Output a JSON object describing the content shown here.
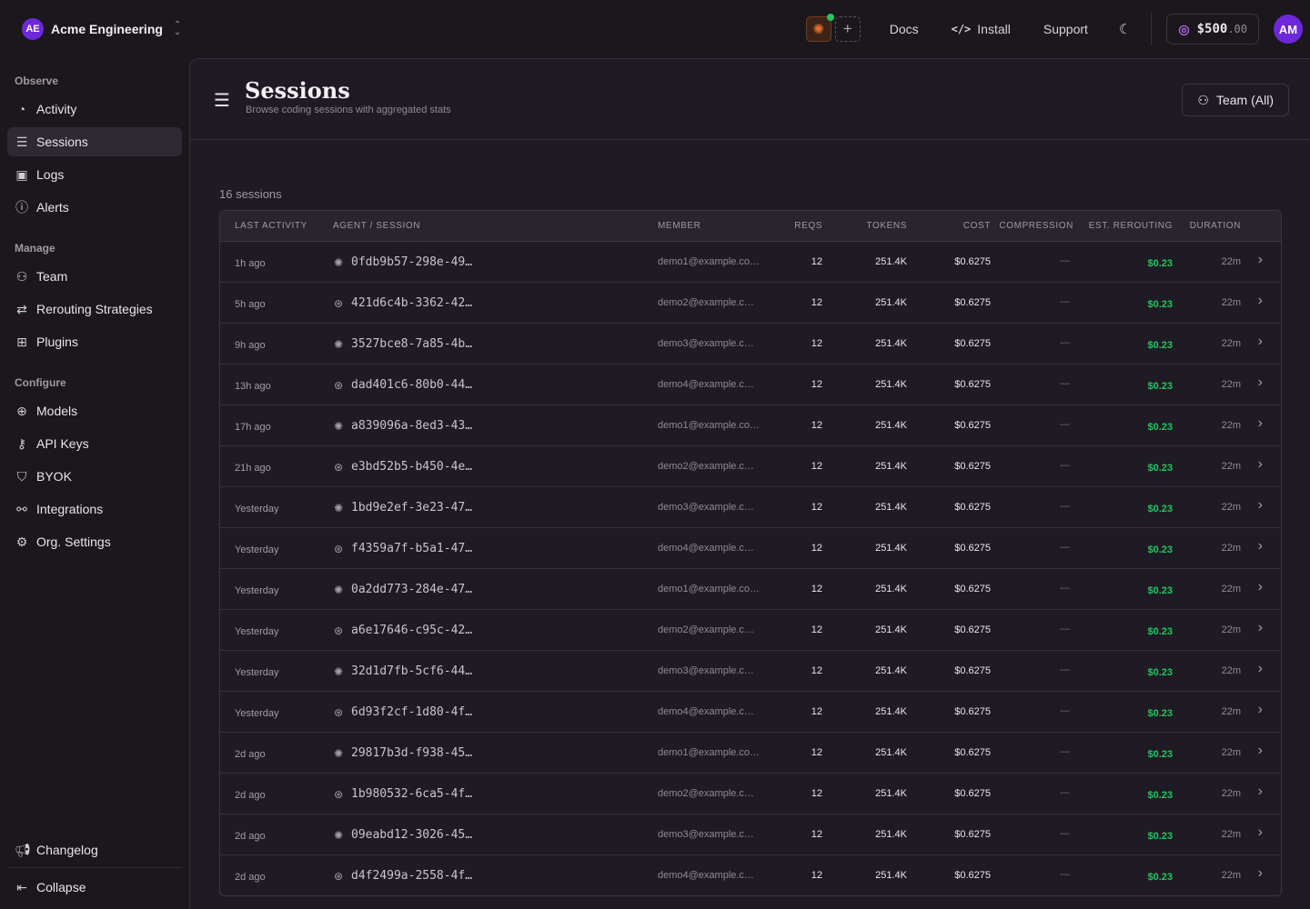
{
  "org": {
    "initials": "AE",
    "name": "Acme Engineering"
  },
  "topnav": {
    "docs": "Docs",
    "install": "Install",
    "support": "Support",
    "credits_main": "$500",
    "credits_cents": ".00",
    "user_initials": "AM"
  },
  "sidebar": {
    "groups": [
      {
        "label": "Observe",
        "items": [
          "Activity",
          "Sessions",
          "Logs",
          "Alerts"
        ]
      },
      {
        "label": "Manage",
        "items": [
          "Team",
          "Rerouting Strategies",
          "Plugins"
        ]
      },
      {
        "label": "Configure",
        "items": [
          "Models",
          "API Keys",
          "BYOK",
          "Integrations",
          "Org. Settings"
        ]
      }
    ],
    "active": "Sessions",
    "changelog": "Changelog",
    "collapse": "Collapse"
  },
  "page": {
    "title": "Sessions",
    "subtitle": "Browse coding sessions with aggregated stats",
    "team_filter": "Team (All)",
    "count_label": "16 sessions"
  },
  "table": {
    "headers": [
      "Last Activity",
      "Agent / Session",
      "Member",
      "Reqs",
      "Tokens",
      "Cost",
      "Compression",
      "Est. Rerouting",
      "Duration"
    ],
    "rows": [
      {
        "time": "1h ago",
        "agent": "claude",
        "session": "0fdb9b57-298e-49…",
        "member": "demo1@example.co…",
        "reqs": "12",
        "tokens": "251.4K",
        "cost": "$0.6275",
        "compression": "—",
        "rerouting": "$0.23",
        "duration": "22m"
      },
      {
        "time": "5h ago",
        "agent": "openai",
        "session": "421d6c4b-3362-42…",
        "member": "demo2@example.c…",
        "reqs": "12",
        "tokens": "251.4K",
        "cost": "$0.6275",
        "compression": "—",
        "rerouting": "$0.23",
        "duration": "22m"
      },
      {
        "time": "9h ago",
        "agent": "claude",
        "session": "3527bce8-7a85-4b…",
        "member": "demo3@example.c…",
        "reqs": "12",
        "tokens": "251.4K",
        "cost": "$0.6275",
        "compression": "—",
        "rerouting": "$0.23",
        "duration": "22m"
      },
      {
        "time": "13h ago",
        "agent": "openai",
        "session": "dad401c6-80b0-44…",
        "member": "demo4@example.c…",
        "reqs": "12",
        "tokens": "251.4K",
        "cost": "$0.6275",
        "compression": "—",
        "rerouting": "$0.23",
        "duration": "22m"
      },
      {
        "time": "17h ago",
        "agent": "claude",
        "session": "a839096a-8ed3-43…",
        "member": "demo1@example.co…",
        "reqs": "12",
        "tokens": "251.4K",
        "cost": "$0.6275",
        "compression": "—",
        "rerouting": "$0.23",
        "duration": "22m"
      },
      {
        "time": "21h ago",
        "agent": "openai",
        "session": "e3bd52b5-b450-4e…",
        "member": "demo2@example.c…",
        "reqs": "12",
        "tokens": "251.4K",
        "cost": "$0.6275",
        "compression": "—",
        "rerouting": "$0.23",
        "duration": "22m"
      },
      {
        "time": "Yesterday",
        "agent": "claude",
        "session": "1bd9e2ef-3e23-47…",
        "member": "demo3@example.c…",
        "reqs": "12",
        "tokens": "251.4K",
        "cost": "$0.6275",
        "compression": "—",
        "rerouting": "$0.23",
        "duration": "22m"
      },
      {
        "time": "Yesterday",
        "agent": "openai",
        "session": "f4359a7f-b5a1-47…",
        "member": "demo4@example.c…",
        "reqs": "12",
        "tokens": "251.4K",
        "cost": "$0.6275",
        "compression": "—",
        "rerouting": "$0.23",
        "duration": "22m"
      },
      {
        "time": "Yesterday",
        "agent": "claude",
        "session": "0a2dd773-284e-47…",
        "member": "demo1@example.co…",
        "reqs": "12",
        "tokens": "251.4K",
        "cost": "$0.6275",
        "compression": "—",
        "rerouting": "$0.23",
        "duration": "22m"
      },
      {
        "time": "Yesterday",
        "agent": "openai",
        "session": "a6e17646-c95c-42…",
        "member": "demo2@example.c…",
        "reqs": "12",
        "tokens": "251.4K",
        "cost": "$0.6275",
        "compression": "—",
        "rerouting": "$0.23",
        "duration": "22m"
      },
      {
        "time": "Yesterday",
        "agent": "claude",
        "session": "32d1d7fb-5cf6-44…",
        "member": "demo3@example.c…",
        "reqs": "12",
        "tokens": "251.4K",
        "cost": "$0.6275",
        "compression": "—",
        "rerouting": "$0.23",
        "duration": "22m"
      },
      {
        "time": "Yesterday",
        "agent": "openai",
        "session": "6d93f2cf-1d80-4f…",
        "member": "demo4@example.c…",
        "reqs": "12",
        "tokens": "251.4K",
        "cost": "$0.6275",
        "compression": "—",
        "rerouting": "$0.23",
        "duration": "22m"
      },
      {
        "time": "2d ago",
        "agent": "claude",
        "session": "29817b3d-f938-45…",
        "member": "demo1@example.co…",
        "reqs": "12",
        "tokens": "251.4K",
        "cost": "$0.6275",
        "compression": "—",
        "rerouting": "$0.23",
        "duration": "22m"
      },
      {
        "time": "2d ago",
        "agent": "openai",
        "session": "1b980532-6ca5-4f…",
        "member": "demo2@example.c…",
        "reqs": "12",
        "tokens": "251.4K",
        "cost": "$0.6275",
        "compression": "—",
        "rerouting": "$0.23",
        "duration": "22m"
      },
      {
        "time": "2d ago",
        "agent": "claude",
        "session": "09eabd12-3026-45…",
        "member": "demo3@example.c…",
        "reqs": "12",
        "tokens": "251.4K",
        "cost": "$0.6275",
        "compression": "—",
        "rerouting": "$0.23",
        "duration": "22m"
      },
      {
        "time": "2d ago",
        "agent": "openai",
        "session": "d4f2499a-2558-4f…",
        "member": "demo4@example.c…",
        "reqs": "12",
        "tokens": "251.4K",
        "cost": "$0.6275",
        "compression": "—",
        "rerouting": "$0.23",
        "duration": "22m"
      }
    ]
  },
  "colors": {
    "accent": "#6d28d9",
    "positive": "#22c55e",
    "claude": "#e26d2e"
  },
  "icons": {
    "agent_claude": "sparkle-icon",
    "agent_openai": "openai-icon"
  }
}
